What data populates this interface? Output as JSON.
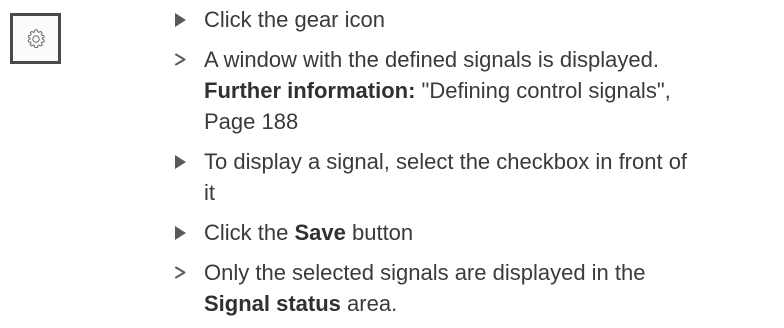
{
  "icon": {
    "name": "gear-icon",
    "description_color": "#4a4a4a"
  },
  "steps": [
    {
      "marker": "action",
      "text": "Click the gear icon"
    },
    {
      "marker": "result",
      "text": "A window with the defined signals is displayed.",
      "further_label": "Further information:",
      "further_text": " \"Defining control signals\",",
      "page_ref": "Page 188"
    },
    {
      "marker": "action",
      "text_line1": "To display a signal, select the checkbox in front of",
      "text_line2": "it"
    },
    {
      "marker": "action",
      "prefix": "Click the ",
      "bold": "Save",
      "suffix": " button"
    },
    {
      "marker": "result",
      "text_line1": "Only the selected signals are displayed in the",
      "bold_line2": "Signal status",
      "suffix_line2": " area."
    }
  ],
  "colors": {
    "text": "#3a3a3a",
    "marker": "#5a5a5a",
    "icon_border": "#4a4a4a"
  }
}
